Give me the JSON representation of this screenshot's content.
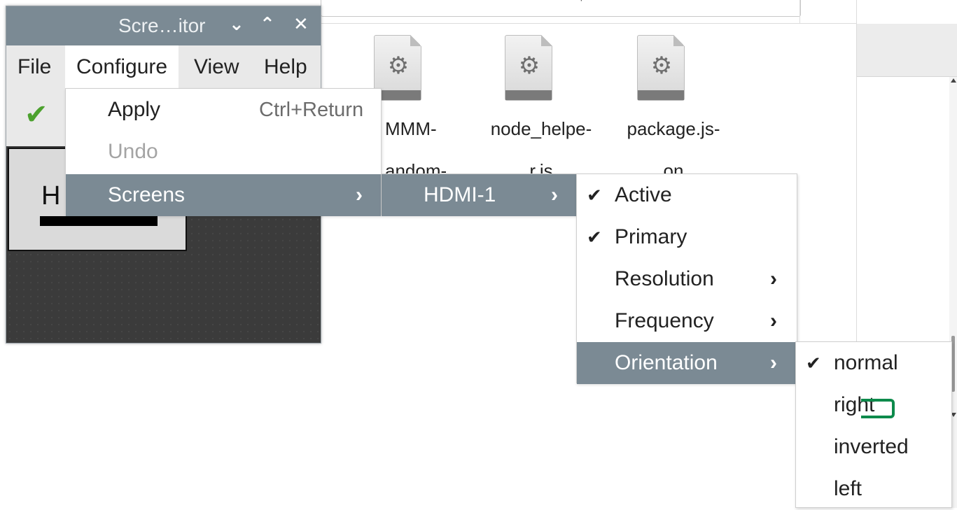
{
  "file_manager": {
    "pathbar_text": "'",
    "files": [
      {
        "name_line1": "MMM-",
        "name_line2": "andom-",
        "icon": "settings-file-icon"
      },
      {
        "name_line1": "node_helpe-",
        "name_line2": "r.js",
        "icon": "settings-file-icon"
      },
      {
        "name_line1": "package.js-",
        "name_line2": "on",
        "icon": "settings-file-icon"
      }
    ]
  },
  "window": {
    "title": "Scre…itor",
    "controls": {
      "minimize": "⌄",
      "maximize": "⌃",
      "close": "✕"
    },
    "menubar": [
      "File",
      "Configure",
      "View",
      "Help"
    ],
    "toolbar": {
      "apply_icon": "checkmark-icon",
      "apply_glyph": "✔"
    },
    "screen_label": "H"
  },
  "configure_menu": {
    "items": [
      {
        "label": "Apply",
        "accel": "Ctrl+Return",
        "enabled": true
      },
      {
        "label": "Undo",
        "accel": "",
        "enabled": false
      },
      {
        "label": "Screens",
        "accel": "",
        "submenu": true,
        "highlighted": true
      }
    ]
  },
  "screens_menu": {
    "items": [
      {
        "label": "HDMI-1",
        "submenu": true,
        "highlighted": true
      }
    ]
  },
  "hdmi_menu": {
    "items": [
      {
        "label": "Active",
        "checked": true
      },
      {
        "label": "Primary",
        "checked": true
      },
      {
        "label": "Resolution",
        "submenu": true
      },
      {
        "label": "Frequency",
        "submenu": true
      },
      {
        "label": "Orientation",
        "submenu": true,
        "highlighted": true
      }
    ]
  },
  "orientation_menu": {
    "items": [
      {
        "label": "normal",
        "checked": true
      },
      {
        "label": "right",
        "checked": false
      },
      {
        "label": "inverted",
        "checked": false
      },
      {
        "label": "left",
        "checked": false
      }
    ]
  },
  "glyphs": {
    "check": "✔",
    "arrow": "›"
  },
  "colors": {
    "highlight": "#7b8a94",
    "titlebar": "#7b8a94",
    "canvas": "#3b3b3b",
    "cursor_mark": "#0d8a4b"
  }
}
